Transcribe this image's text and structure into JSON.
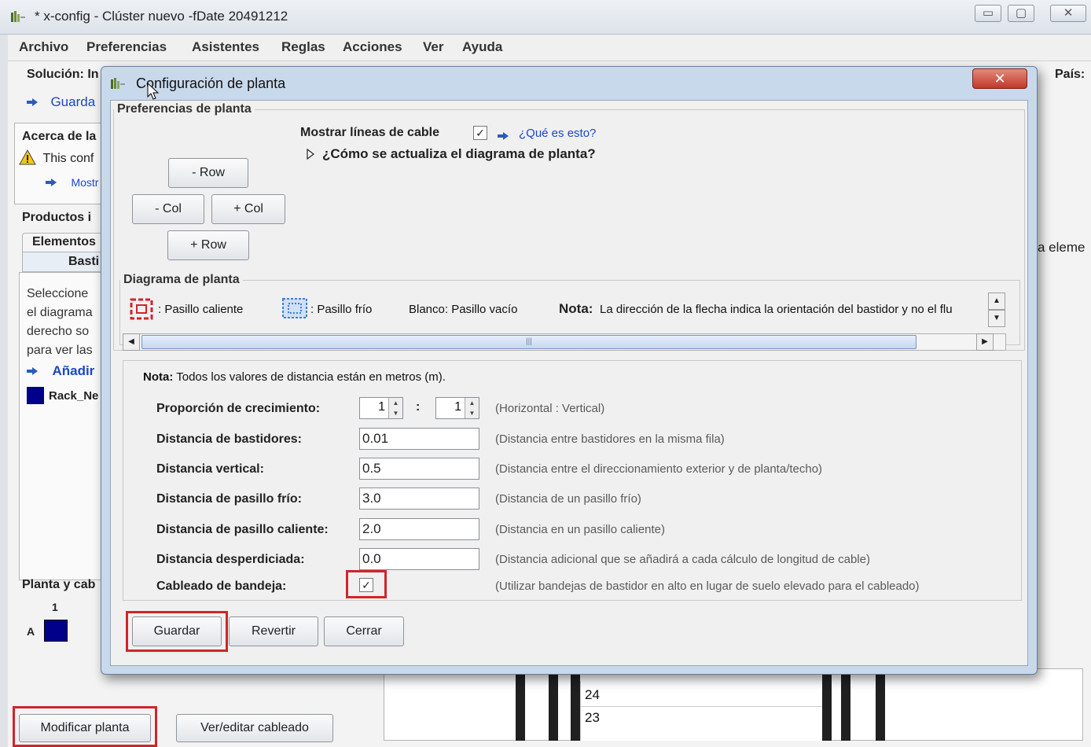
{
  "window": {
    "title": "* x-config - Clúster nuevo -fDate 20491212",
    "controls": [
      "▭",
      "▢",
      "✕"
    ]
  },
  "menubar": [
    "Archivo",
    "Preferencias",
    "Asistentes",
    "Reglas",
    "Acciones",
    "Ver",
    "Ayuda"
  ],
  "left_pane": {
    "solucion_label": "Solución: In",
    "guardar_link": "Guarda",
    "acerca_title": "Acerca de la",
    "warning_text": "This conf",
    "mostrar_link": "Mostr",
    "productos_title": "Productos i",
    "tab_elementos": "Elementos",
    "tab_bastidores": "Basti",
    "instructions": [
      "Seleccione",
      "el diagrama",
      "derecho so",
      "para ver las"
    ],
    "anadir_link": "Añadir",
    "rack_name": "Rack_Ne",
    "planta_title": "Planta y cab",
    "grid_col": "1",
    "grid_row": "A",
    "rack_color": "#00008b",
    "btn_modificar": "Modificar planta",
    "btn_ver_editar": "Ver/editar cableado"
  },
  "right_pane": {
    "pais_label": "País:",
    "eleme_text": "a eleme",
    "rack_numbers": [
      "24",
      "23"
    ]
  },
  "dialog": {
    "title": "Configuración de planta",
    "close": "✕",
    "preferencias_legend": "Preferencias de planta",
    "mostrar_lineas_label": "Mostrar líneas de cable",
    "mostrar_lineas_checked": "✓",
    "que_es_link": "¿Qué es esto?",
    "como_actualiza": "¿Cómo se actualiza el diagrama de planta?",
    "buttons": {
      "minus_row": "- Row",
      "minus_col": "- Col",
      "plus_col": "+ Col",
      "plus_row": "+ Row"
    },
    "diagrama_legend": "Diagrama de planta",
    "legend_hot": ": Pasillo caliente",
    "legend_cold": ": Pasillo frío",
    "legend_blank": "Blanco: Pasillo vacío",
    "nota_label": "Nota:",
    "nota_text": "La dirección de la flecha indica la orientación del bastidor y no el flu",
    "hot_color": "#d0252a",
    "cold_color": "#3d7bd8",
    "settings": {
      "nota_label": "Nota:",
      "nota_text": "Todos los valores de distancia están en metros (m).",
      "rows": [
        {
          "label": "Proporción de crecimiento:",
          "hint": "(Horizontal : Vertical)"
        },
        {
          "label": "Distancia de bastidores:",
          "value": "0.01",
          "hint": "(Distancia entre bastidores en la misma fila)"
        },
        {
          "label": "Distancia vertical:",
          "value": "0.5",
          "hint": "(Distancia entre el direccionamiento exterior y de planta/techo)"
        },
        {
          "label": "Distancia de pasillo frío:",
          "value": "3.0",
          "hint": "(Distancia de un pasillo frío)"
        },
        {
          "label": "Distancia de pasillo caliente:",
          "value": "2.0",
          "hint": "(Distancia en un pasillo caliente)"
        },
        {
          "label": "Distancia desperdiciada:",
          "value": "0.0",
          "hint": "(Distancia adicional que se añadirá a cada cálculo de longitud de cable)"
        },
        {
          "label": "Cableado de bandeja:",
          "checked": "✓",
          "hint": "(Utilizar bandejas de bastidor en alto en lugar de suelo elevado para el cableado)"
        }
      ],
      "ratio_h": "1",
      "ratio_sep": ":",
      "ratio_v": "1"
    },
    "footer": {
      "guardar": "Guardar",
      "revertir": "Revertir",
      "cerrar": "Cerrar"
    }
  }
}
